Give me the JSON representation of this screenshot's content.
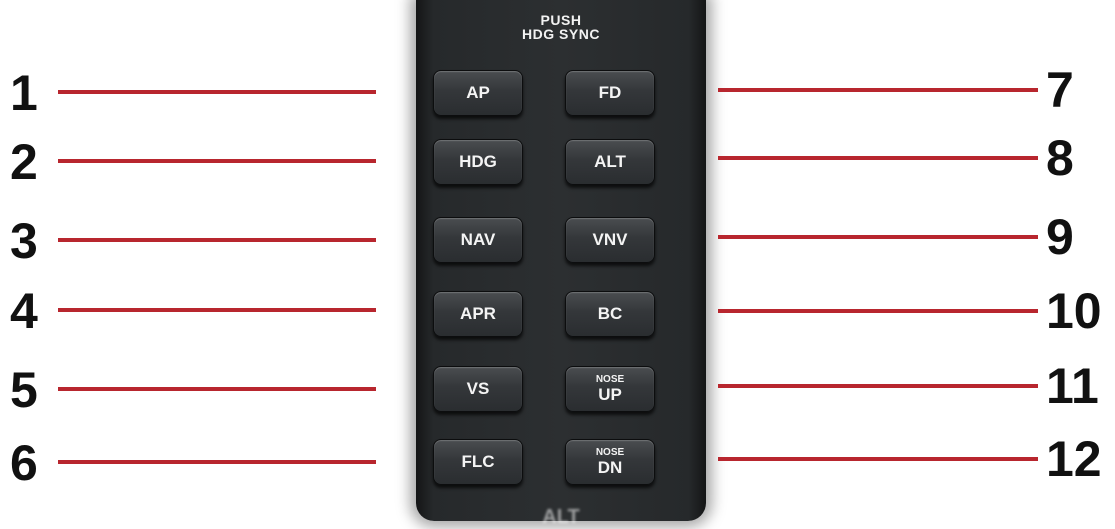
{
  "panel": {
    "header_line1": "PUSH",
    "header_line2": "HDG SYNC",
    "footer_partial": "ALT"
  },
  "buttons": {
    "ap": "AP",
    "fd": "FD",
    "hdg": "HDG",
    "alt": "ALT",
    "nav": "NAV",
    "vnv": "VNV",
    "apr": "APR",
    "bc": "BC",
    "vs": "VS",
    "nose_up_top": "NOSE",
    "nose_up_bottom": "UP",
    "flc": "FLC",
    "nose_dn_top": "NOSE",
    "nose_dn_bottom": "DN"
  },
  "callouts": {
    "left": [
      "1",
      "2",
      "3",
      "4",
      "5",
      "6"
    ],
    "right": [
      "7",
      "8",
      "9",
      "10",
      "11",
      "12"
    ]
  },
  "colors": {
    "leader_line": "#b8262e",
    "panel": "#2c2f31",
    "button_text": "#f4f4f4"
  }
}
